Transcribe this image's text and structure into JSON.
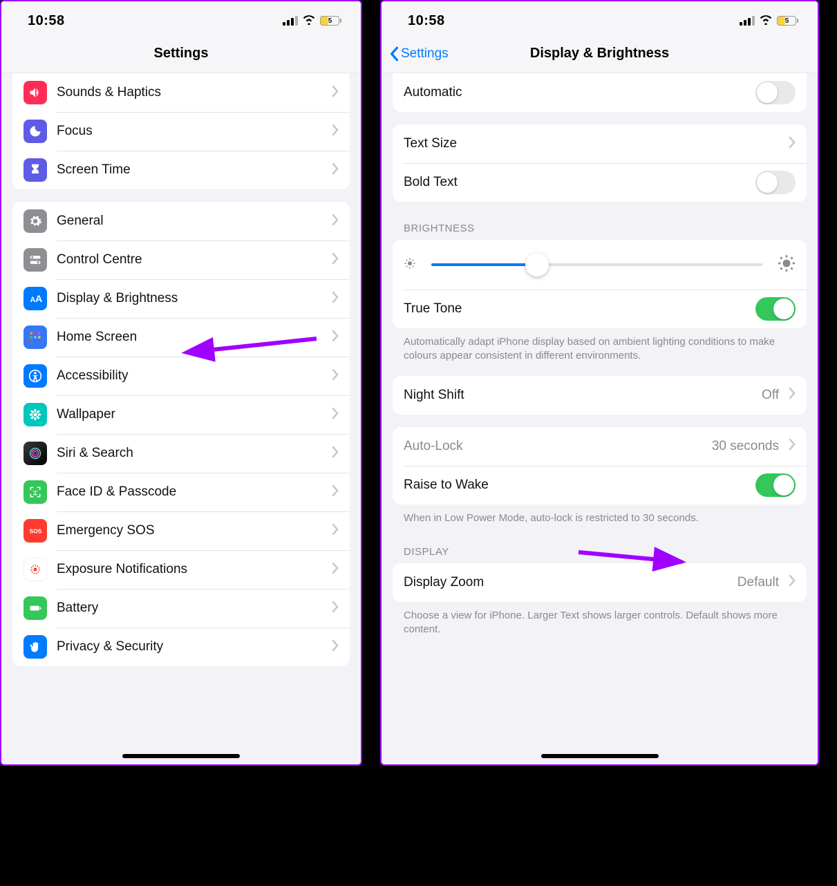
{
  "shared": {
    "clock": "10:58",
    "battery": "5"
  },
  "left": {
    "title": "Settings",
    "groups": [
      {
        "rows": [
          {
            "label": "Sounds & Haptics",
            "icon": "speaker-icon",
            "color": "bg-orange-red"
          },
          {
            "label": "Focus",
            "icon": "moon-icon",
            "color": "bg-indigo"
          },
          {
            "label": "Screen Time",
            "icon": "hourglass-icon",
            "color": "bg-indigo"
          }
        ]
      },
      {
        "rows": [
          {
            "label": "General",
            "icon": "gear-icon",
            "color": "bg-grey"
          },
          {
            "label": "Control Centre",
            "icon": "switches-icon",
            "color": "bg-grey"
          },
          {
            "label": "Display & Brightness",
            "icon": "aa-icon",
            "color": "bg-blue"
          },
          {
            "label": "Home Screen",
            "icon": "grid-icon",
            "color": "bg-home"
          },
          {
            "label": "Accessibility",
            "icon": "accessibility-icon",
            "color": "bg-blue"
          },
          {
            "label": "Wallpaper",
            "icon": "flower-icon",
            "color": "bg-teal"
          },
          {
            "label": "Siri & Search",
            "icon": "siri-icon",
            "color": "bg-siri"
          },
          {
            "label": "Face ID & Passcode",
            "icon": "faceid-icon",
            "color": "bg-green"
          },
          {
            "label": "Emergency SOS",
            "icon": "sos-icon",
            "color": "bg-red"
          },
          {
            "label": "Exposure Notifications",
            "icon": "exposure-icon",
            "color": "bg-white-dots"
          },
          {
            "label": "Battery",
            "icon": "battery-icon",
            "color": "bg-green"
          },
          {
            "label": "Privacy & Security",
            "icon": "hand-icon",
            "color": "bg-blue"
          }
        ]
      }
    ]
  },
  "right": {
    "back": "Settings",
    "title": "Display & Brightness",
    "rows": {
      "automatic": "Automatic",
      "text_size": "Text Size",
      "bold_text": "Bold Text",
      "true_tone": "True Tone",
      "night_shift": "Night Shift",
      "night_shift_val": "Off",
      "auto_lock": "Auto-Lock",
      "auto_lock_val": "30 seconds",
      "raise_wake": "Raise to Wake",
      "display_zoom": "Display Zoom",
      "display_zoom_val": "Default"
    },
    "headers": {
      "brightness": "BRIGHTNESS",
      "display": "DISPLAY"
    },
    "footers": {
      "true_tone": "Automatically adapt iPhone display based on ambient lighting conditions to make colours appear consistent in different environments.",
      "raise_wake": "When in Low Power Mode, auto-lock is restricted to 30 seconds.",
      "display_zoom": "Choose a view for iPhone. Larger Text shows larger controls. Default shows more content."
    },
    "toggles": {
      "automatic": false,
      "bold_text": false,
      "true_tone": true,
      "raise_wake": true
    },
    "brightness_pct": 32
  }
}
